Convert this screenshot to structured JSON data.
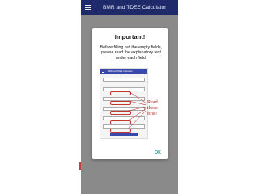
{
  "app": {
    "title": "BMR and TDEE Calculator"
  },
  "dialog": {
    "title": "Important!",
    "message": "Before filling out the empty fields, please read the explanatory text under each field!",
    "ok_label": "OK",
    "illustration": {
      "app_title": "BMR and TDEE Calculator",
      "annotation": "Read these first!"
    }
  },
  "colors": {
    "appbar": "#1f2a6b",
    "dim_overlay": "#8a8a8a",
    "ok_accent": "#2a9d8f",
    "annotation_red": "#b01818"
  }
}
